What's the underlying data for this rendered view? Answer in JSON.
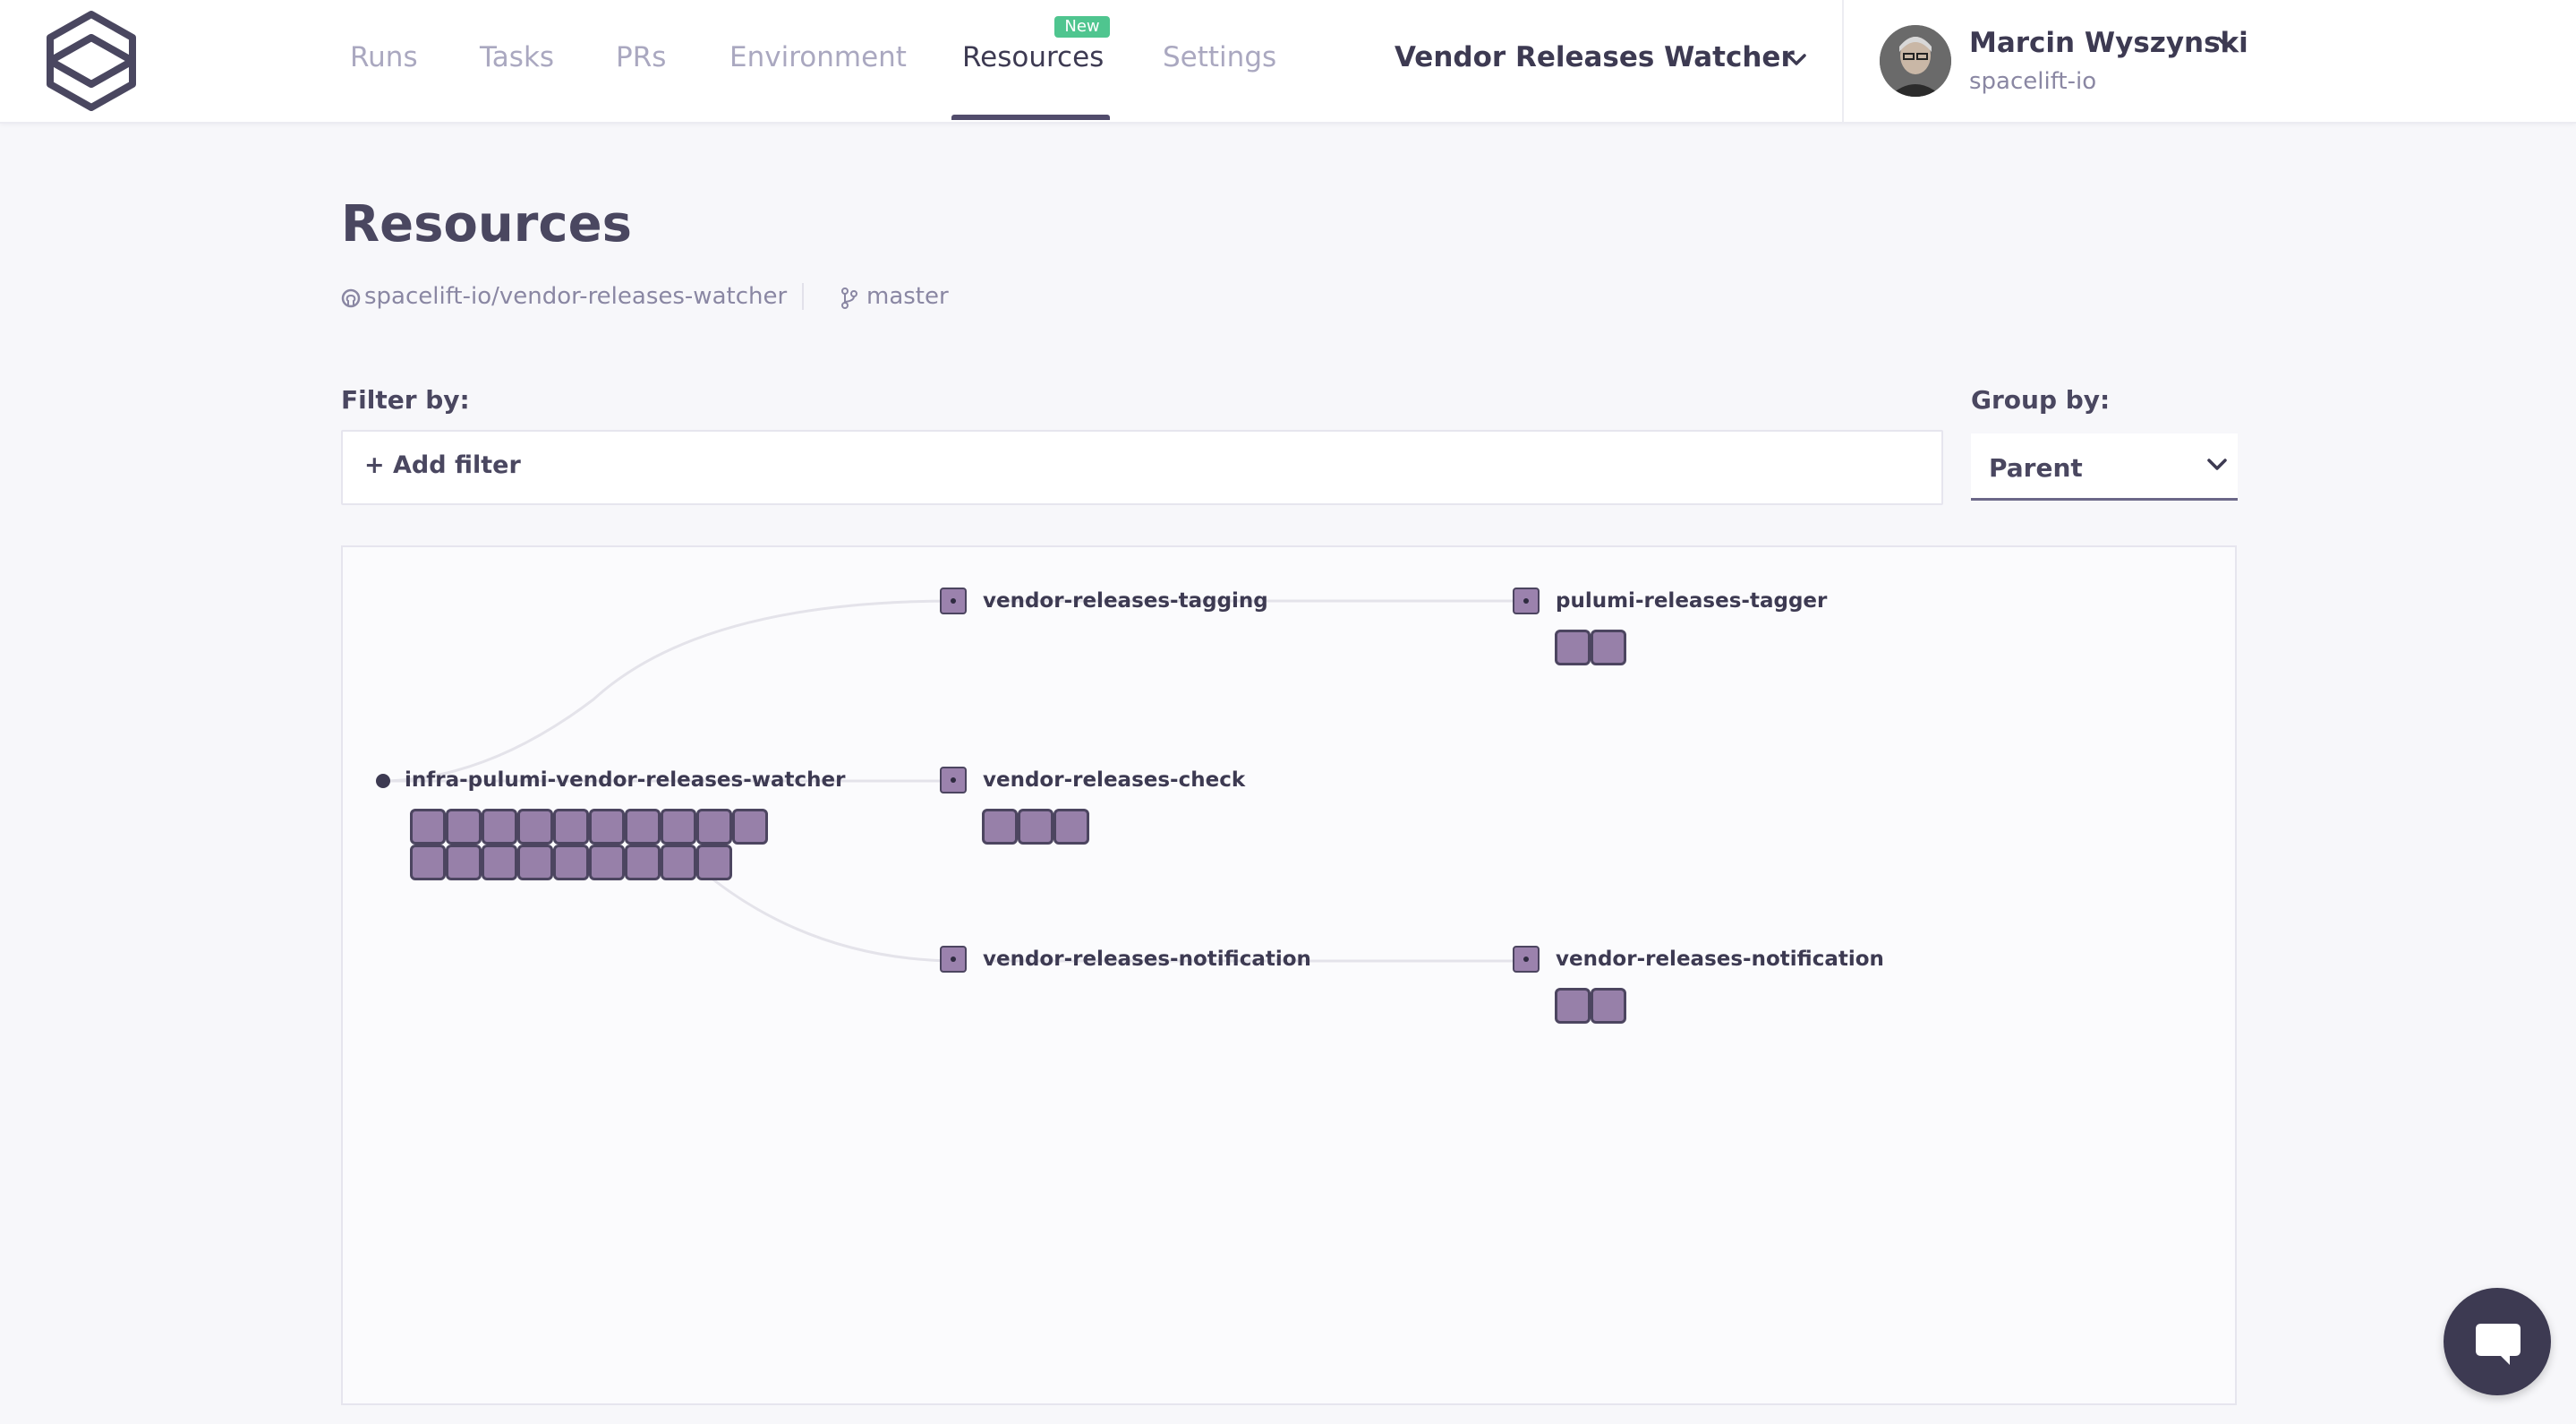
{
  "header": {
    "nav_tabs": [
      {
        "label": "Runs",
        "active": false
      },
      {
        "label": "Tasks",
        "active": false
      },
      {
        "label": "PRs",
        "active": false
      },
      {
        "label": "Environment",
        "active": false
      },
      {
        "label": "Resources",
        "active": true,
        "badge": "New"
      },
      {
        "label": "Settings",
        "active": false
      }
    ],
    "stack_name": "Vendor Releases Watcher",
    "user": {
      "name": "Marcin Wyszynski",
      "org": "spacelift-io"
    }
  },
  "page": {
    "title": "Resources",
    "repo": "spacelift-io/vendor-releases-watcher",
    "branch": "master",
    "filter_label": "Filter by:",
    "add_filter_label": "+ Add filter",
    "group_label": "Group by:",
    "group_value": "Parent"
  },
  "graph": {
    "root": {
      "label": "infra-pulumi-vendor-releases-watcher",
      "resource_count": 19
    },
    "children": [
      {
        "label": "vendor-releases-tagging",
        "resource_count": 0,
        "children": [
          {
            "label": "pulumi-releases-tagger",
            "resource_count": 2
          }
        ]
      },
      {
        "label": "vendor-releases-check",
        "resource_count": 3,
        "children": []
      },
      {
        "label": "vendor-releases-notification",
        "resource_count": 0,
        "children": [
          {
            "label": "vendor-releases-notification",
            "resource_count": 2
          }
        ]
      }
    ]
  },
  "colors": {
    "accent": "#514c6c",
    "new_badge": "#4fc58f",
    "resource_fill": "#9780a9",
    "resource_border": "#4c4560",
    "text_primary": "#3d3a52",
    "text_muted": "#aaa8c0"
  },
  "icons": {
    "logo": "spacelift-logo",
    "repo": "github-icon",
    "branch": "git-branch-icon",
    "chat": "chat-bubble-icon"
  }
}
